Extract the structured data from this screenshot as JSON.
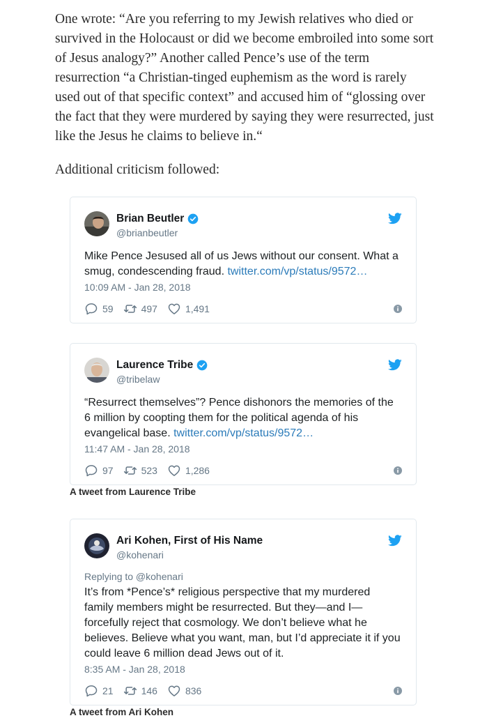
{
  "article": {
    "paragraph_1": "One wrote: “Are you referring to my Jewish relatives who died or survived in the Holocaust or did we become embroiled into some sort of Jesus analogy?” Another called Pence’s use of the term resurrection “a Christian-tinged euphemism as the word is rarely used out of that specific context” and accused him of “glossing over the fact that they were murdered by saying they were resurrected, just like the Jesus he claims to believe in.“",
    "paragraph_2": "Additional criticism followed:"
  },
  "tweets": [
    {
      "name": "Brian Beutler",
      "handle": "@brianbeutler",
      "text": "Mike Pence Jesused all of us Jews without our consent. What a smug, condescending fraud. ",
      "link": "twitter.com/vp/status/9572…",
      "time": "10:09 AM - Jan 28, 2018",
      "replies": "59",
      "retweets": "497",
      "likes": "1,491"
    },
    {
      "name": "Laurence Tribe",
      "handle": "@tribelaw",
      "text": "“Resurrect themselves”? Pence dishonors the memories of the 6 million by coopting them for the political agenda of his evangelical base. ",
      "link": "twitter.com/vp/status/9572…",
      "time": "11:47 AM - Jan 28, 2018",
      "replies": "97",
      "retweets": "523",
      "likes": "1,286",
      "caption": "A tweet from Laurence Tribe"
    },
    {
      "name": "Ari Kohen, First of His Name",
      "handle": "@kohenari",
      "reply_to": "Replying to @kohenari",
      "text": "It’s from *Pence’s* religious perspective that my murdered family members might be resurrected. But they—and I—forcefully reject that cosmology. We don’t believe what he believes. Believe what you want, man, but I’d appreciate it if you could leave 6 million dead Jews out of it.",
      "time": "8:35 AM - Jan 28, 2018",
      "replies": "21",
      "retweets": "146",
      "likes": "836",
      "caption": "A tweet from Ari Kohen"
    }
  ],
  "colors": {
    "twitter_blue": "#1da1f2",
    "link": "#2b7bb9",
    "muted": "#657786"
  },
  "icons": [
    "verified-badge-icon",
    "twitter-bird-icon",
    "reply-icon",
    "retweet-icon",
    "like-icon",
    "info-icon"
  ]
}
